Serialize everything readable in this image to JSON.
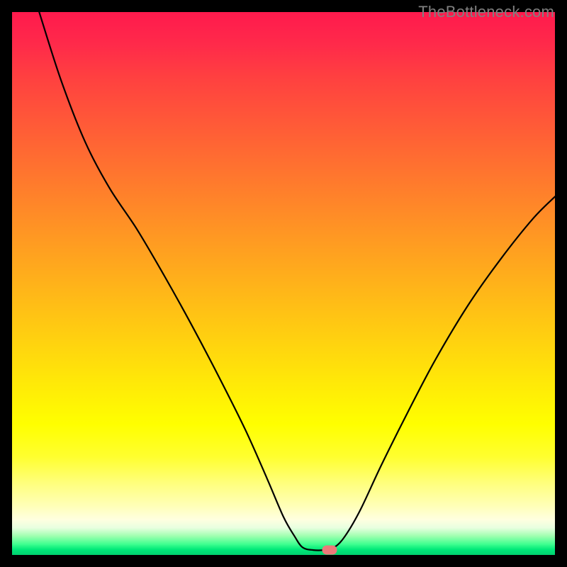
{
  "watermark": "TheBottleneck.com",
  "chart_data": {
    "type": "line",
    "title": "",
    "xlabel": "",
    "ylabel": "",
    "xlim": [
      0,
      100
    ],
    "ylim": [
      0,
      100
    ],
    "grid": false,
    "curve": {
      "type": "v-curve",
      "strokeColor": "#000000",
      "strokeWidth": 2.2,
      "points": [
        {
          "x": 5.0,
          "y": 100.0
        },
        {
          "x": 9.0,
          "y": 87.5
        },
        {
          "x": 13.5,
          "y": 76.0
        },
        {
          "x": 18.0,
          "y": 67.5
        },
        {
          "x": 23.0,
          "y": 60.0
        },
        {
          "x": 28.0,
          "y": 51.5
        },
        {
          "x": 33.0,
          "y": 42.5
        },
        {
          "x": 38.0,
          "y": 33.0
        },
        {
          "x": 43.0,
          "y": 23.0
        },
        {
          "x": 47.0,
          "y": 14.0
        },
        {
          "x": 50.0,
          "y": 7.0
        },
        {
          "x": 52.0,
          "y": 3.5
        },
        {
          "x": 53.5,
          "y": 1.4
        },
        {
          "x": 55.5,
          "y": 0.9
        },
        {
          "x": 57.5,
          "y": 0.9
        },
        {
          "x": 59.0,
          "y": 1.2
        },
        {
          "x": 61.0,
          "y": 3.0
        },
        {
          "x": 64.0,
          "y": 8.0
        },
        {
          "x": 68.0,
          "y": 16.5
        },
        {
          "x": 73.0,
          "y": 26.5
        },
        {
          "x": 78.0,
          "y": 36.0
        },
        {
          "x": 84.0,
          "y": 46.0
        },
        {
          "x": 90.0,
          "y": 54.5
        },
        {
          "x": 96.0,
          "y": 62.0
        },
        {
          "x": 100.0,
          "y": 66.0
        }
      ]
    },
    "marker": {
      "x": 58.5,
      "y": 0.9,
      "color": "#eb7a7a",
      "shape": "rounded-rect"
    },
    "gradient_stops": [
      {
        "pos": 0.0,
        "color": "#ff1a4d"
      },
      {
        "pos": 0.5,
        "color": "#ffb018"
      },
      {
        "pos": 0.76,
        "color": "#ffff00"
      },
      {
        "pos": 0.94,
        "color": "#ffffe0"
      },
      {
        "pos": 1.0,
        "color": "#00d070"
      }
    ]
  }
}
